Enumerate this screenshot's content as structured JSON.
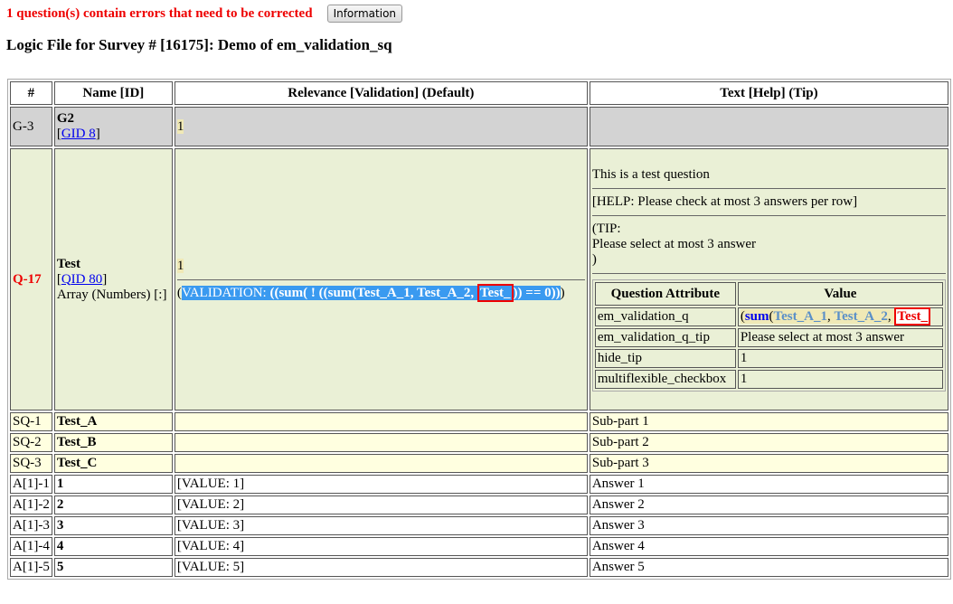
{
  "error_message": "1 question(s) contain errors that need to be corrected",
  "info_button": "Information",
  "title": "Logic File for Survey # [16175]: Demo of em_validation_sq",
  "headers": [
    "#",
    "Name [ID]",
    "Relevance [Validation] (Default)",
    "Text [Help] (Tip)"
  ],
  "group": {
    "num": "G-3",
    "name": "G2",
    "link_open": "[",
    "link": "GID 8",
    "link_close": "]",
    "relevance": "1"
  },
  "question": {
    "num": "Q-17",
    "name": "Test",
    "link_open": "[",
    "link": "QID 80",
    "link_close": "]",
    "type": "Array (Numbers) [:]",
    "relevance": "1",
    "validation_open": "(",
    "validation_prefix": "VALIDATION: ",
    "validation_bold": "((sum( ! ((sum(Test_A_1, Test_A_2, ",
    "validation_err": "Test_",
    "validation_tail": ")) == 0))",
    "validation_close": ")",
    "text": "This is a test question",
    "help": "[HELP: Please check at most 3 answers per row]",
    "tip_open": "(TIP:",
    "tip": "Please select at most 3 answer",
    "tip_close": ")",
    "attr_headers": [
      "Question Attribute",
      "Value"
    ],
    "attributes": [
      {
        "name": "em_validation_q",
        "v_open": "(",
        "v_fn": "sum",
        "v_paren": "(",
        "v_var1": "Test_A_1",
        "v_sep1": ", ",
        "v_var2": "Test_A_2",
        "v_sep2": ", ",
        "v_err": "Test_"
      },
      {
        "name": "em_validation_q_tip",
        "value": "Please select at most 3 answer"
      },
      {
        "name": "hide_tip",
        "value": "1"
      },
      {
        "name": "multiflexible_checkbox",
        "value": "1"
      }
    ]
  },
  "subquestions": [
    {
      "num": "SQ-1",
      "name": "Test_A",
      "text": "Sub-part 1"
    },
    {
      "num": "SQ-2",
      "name": "Test_B",
      "text": "Sub-part 2"
    },
    {
      "num": "SQ-3",
      "name": "Test_C",
      "text": "Sub-part 3"
    }
  ],
  "answers": [
    {
      "num": "A[1]-1",
      "name": "1",
      "value": "[VALUE: 1]",
      "text": "Answer 1"
    },
    {
      "num": "A[1]-2",
      "name": "2",
      "value": "[VALUE: 2]",
      "text": "Answer 2"
    },
    {
      "num": "A[1]-3",
      "name": "3",
      "value": "[VALUE: 3]",
      "text": "Answer 3"
    },
    {
      "num": "A[1]-4",
      "name": "4",
      "value": "[VALUE: 4]",
      "text": "Answer 4"
    },
    {
      "num": "A[1]-5",
      "name": "5",
      "value": "[VALUE: 5]",
      "text": "Answer 5"
    }
  ]
}
